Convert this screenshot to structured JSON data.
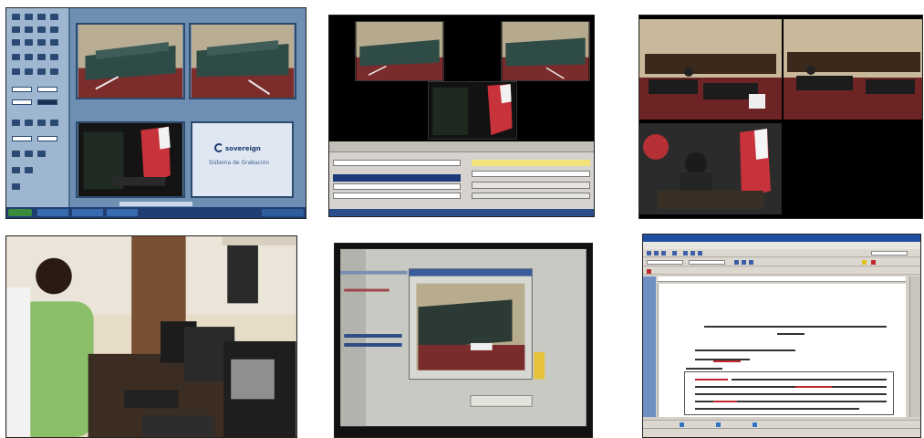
{
  "panels": [
    {
      "id": "video-control-app",
      "logo_brand": "sovereign",
      "logo_sub": "Sistema de Grabación"
    },
    {
      "id": "three-camera-grid"
    },
    {
      "id": "hearing-multiview"
    },
    {
      "id": "workstation-photo"
    },
    {
      "id": "monitor-photo"
    },
    {
      "id": "document-editor"
    }
  ],
  "colors": {
    "app_blue": "#6e8fb3",
    "panel_light": "#dfe7f2",
    "courtroom_wall": "#c8b99b",
    "courtroom_floor": "#7a2b2b",
    "bench_green": "#2f4b46",
    "flag_red": "#c8323a",
    "taskbar_blue": "#2a4f8c",
    "document_red": "#c0282d"
  }
}
